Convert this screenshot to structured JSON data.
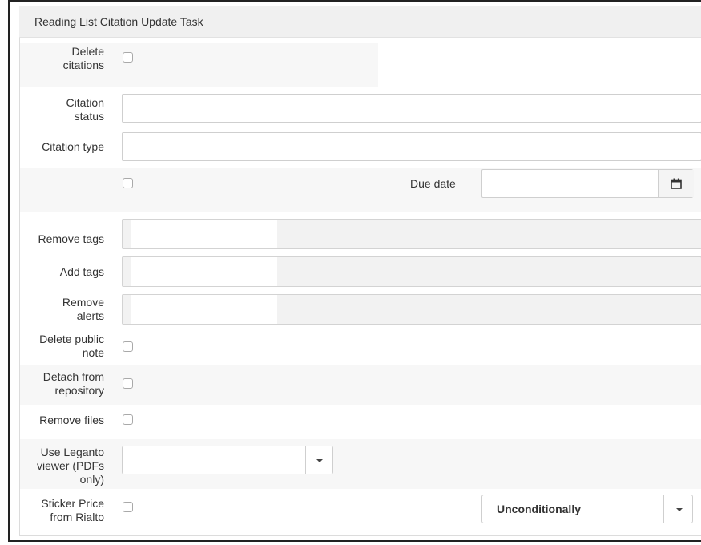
{
  "panel": {
    "title": "Reading List Citation Update Task"
  },
  "fields": {
    "delete_citations": {
      "label_1": "Delete",
      "label_2": "citations"
    },
    "citation_status": {
      "label_1": "Citation",
      "label_2": "status",
      "value": ""
    },
    "citation_type": {
      "label": "Citation type",
      "value": ""
    },
    "due_date": {
      "label": "Due date",
      "value": ""
    },
    "remove_tags": {
      "label": "Remove tags"
    },
    "add_tags": {
      "label": "Add tags"
    },
    "remove_alerts": {
      "label_1": "Remove",
      "label_2": "alerts"
    },
    "delete_public_note": {
      "label_1": "Delete public",
      "label_2": "note"
    },
    "detach_repository": {
      "label_1": "Detach from",
      "label_2": "repository"
    },
    "remove_files": {
      "label": "Remove files"
    },
    "leganto_viewer": {
      "label_1": "Use Leganto",
      "label_2": "viewer (PDFs",
      "label_3": "only)",
      "value": ""
    },
    "sticker_price": {
      "label_1": "Sticker Price",
      "label_2": "from Rialto",
      "condition_value": "Unconditionally"
    }
  },
  "icons": {
    "calendar": "calendar-icon",
    "dropdown": "caret-down-icon"
  },
  "colors": {
    "header_bg": "#f0f0f0",
    "row_bg": "#f7f7f7",
    "border": "#cfcfcf"
  }
}
